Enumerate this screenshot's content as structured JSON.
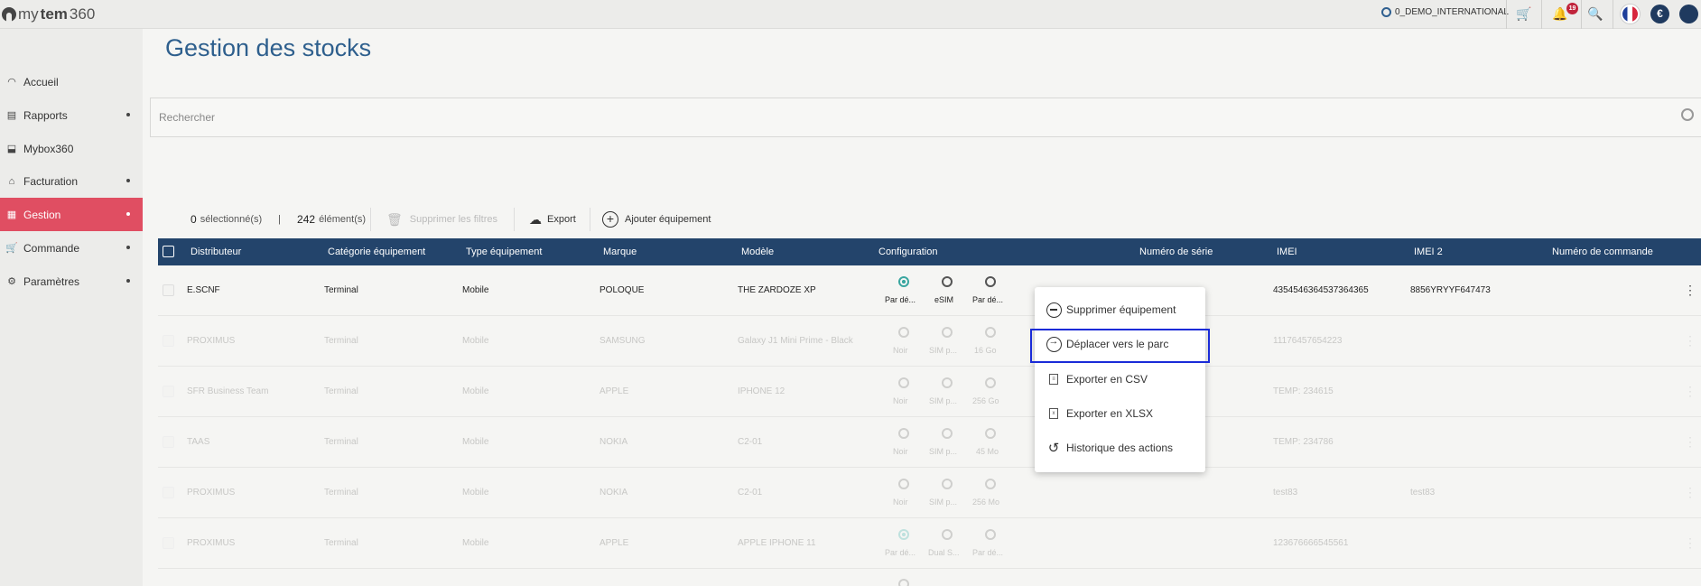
{
  "app": {
    "logo_prefix": "my",
    "logo_brand": "tem",
    "logo_suffix": "360"
  },
  "topbar": {
    "account": "0_DEMO_INTERNATIONAL",
    "notifications": "19",
    "currency": "€"
  },
  "sidebar": {
    "items": [
      {
        "label": "Accueil",
        "icon": "dashboard-icon"
      },
      {
        "label": "Rapports",
        "icon": "report-icon"
      },
      {
        "label": "Mybox360",
        "icon": "inbox-icon"
      },
      {
        "label": "Facturation",
        "icon": "bank-icon"
      },
      {
        "label": "Gestion",
        "icon": "grid-icon",
        "active": true
      },
      {
        "label": "Commande",
        "icon": "cart-icon"
      },
      {
        "label": "Paramètres",
        "icon": "settings-icon"
      }
    ]
  },
  "page": {
    "title": "Gestion des stocks"
  },
  "search": {
    "placeholder": "Rechercher"
  },
  "toolbar": {
    "selected_count": "0",
    "selected_label": "sélectionné(s)",
    "separator": "|",
    "total_count": "242",
    "total_label": "élément(s)",
    "clear_filters": "Supprimer les filtres",
    "export": "Export",
    "add_equipment": "Ajouter équipement"
  },
  "table": {
    "columns": [
      "Distributeur",
      "Catégorie équipement",
      "Type équipement",
      "Marque",
      "Modèle",
      "Configuration",
      "Numéro de série",
      "IMEI",
      "IMEI 2",
      "Numéro de commande"
    ],
    "rows": [
      {
        "distributeur": "E.SCNF",
        "categorie": "Terminal",
        "type": "Mobile",
        "marque": "POLOQUE",
        "modele": "THE ZARDOZE XP",
        "cfg": [
          "Par dé...",
          "eSIM",
          "Par dé..."
        ],
        "serie": "",
        "imei": "4354546364537364365",
        "imei2": "8856YRYYF647473"
      },
      {
        "distributeur": "PROXIMUS",
        "categorie": "Terminal",
        "type": "Mobile",
        "marque": "SAMSUNG",
        "modele": "Galaxy J1 Mini Prime - Black",
        "cfg": [
          "Noir",
          "SIM p...",
          "16 Go"
        ],
        "serie": "",
        "imei": "11176457654223",
        "imei2": ""
      },
      {
        "distributeur": "SFR Business Team",
        "categorie": "Terminal",
        "type": "Mobile",
        "marque": "APPLE",
        "modele": "IPHONE 12",
        "cfg": [
          "Noir",
          "SIM p...",
          "256 Go"
        ],
        "serie": "",
        "imei": "TEMP: 234615",
        "imei2": ""
      },
      {
        "distributeur": "TAAS",
        "categorie": "Terminal",
        "type": "Mobile",
        "marque": "NOKIA",
        "modele": "C2-01",
        "cfg": [
          "Noir",
          "SIM p...",
          "45 Mo"
        ],
        "serie": "",
        "imei": "TEMP: 234786",
        "imei2": ""
      },
      {
        "distributeur": "PROXIMUS",
        "categorie": "Terminal",
        "type": "Mobile",
        "marque": "NOKIA",
        "modele": "C2-01",
        "cfg": [
          "Noir",
          "SIM p...",
          "256 Mo"
        ],
        "serie": "",
        "imei": "test83",
        "imei2": "test83"
      },
      {
        "distributeur": "PROXIMUS",
        "categorie": "Terminal",
        "type": "Mobile",
        "marque": "APPLE",
        "modele": "APPLE IPHONE 11",
        "cfg": [
          "Par dé...",
          "Dual S...",
          "Par dé..."
        ],
        "serie": "",
        "imei": "123676666545561",
        "imei2": ""
      }
    ]
  },
  "context_menu": {
    "items": [
      {
        "label": "Supprimer équipement",
        "icon": "minus-circle-icon"
      },
      {
        "label": "Déplacer vers le parc",
        "icon": "arrow-circle-icon"
      },
      {
        "label": "Exporter en CSV",
        "icon": "csv-file-icon"
      },
      {
        "label": "Exporter en XLSX",
        "icon": "xlsx-file-icon"
      },
      {
        "label": "Historique des actions",
        "icon": "history-icon"
      }
    ]
  }
}
